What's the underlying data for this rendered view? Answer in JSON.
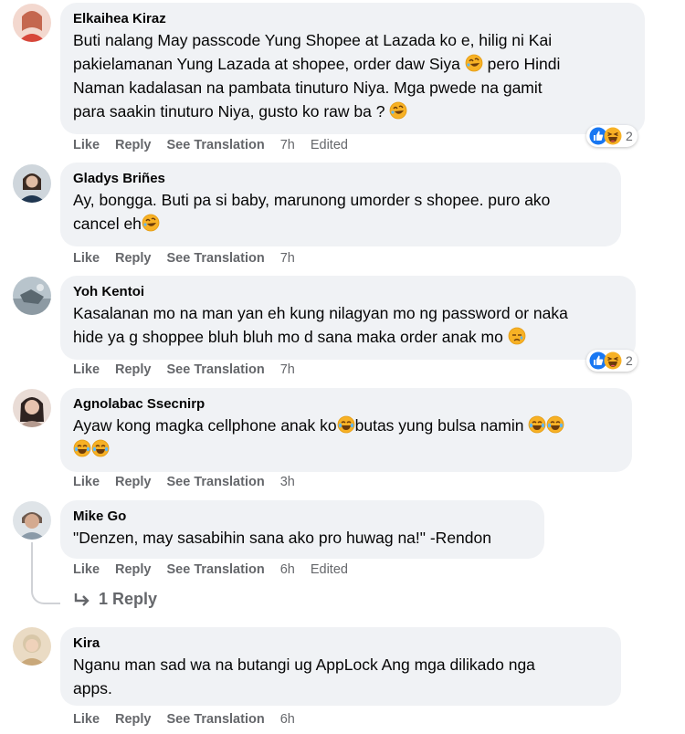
{
  "actions": {
    "like": "Like",
    "reply": "Reply",
    "see_translation": "See Translation"
  },
  "comments": [
    {
      "author": "Elkaihea Kiraz",
      "lines": [
        "Buti nalang May passcode Yung Shopee at Lazada ko e, hilig ni Kai",
        "pakielamanan Yung Lazada at shopee, order daw Siya",
        "pero Hindi",
        "Naman kadalasan na pambata tinuturo Niya. Mga pwede na gamit",
        "para saakin tinuturo Niya, gusto ko raw ba ?"
      ],
      "time": "7h",
      "edited": "Edited",
      "reaction_count": "2"
    },
    {
      "author": "Gladys Briñes",
      "lines": [
        "Ay, bongga. Buti pa si baby, marunong umorder s shopee. puro ako",
        "cancel eh"
      ],
      "time": "7h"
    },
    {
      "author": "Yoh Kentoi",
      "lines": [
        "Kasalanan mo na man yan eh kung nilagyan mo ng password or naka",
        "hide ya g shoppee bluh bluh mo d sana maka order anak mo"
      ],
      "time": "7h",
      "reaction_count": "2"
    },
    {
      "author": "Agnolabac Ssecnirp",
      "lines": [
        "Ayaw kong magka cellphone anak ko",
        "butas yung bulsa namin"
      ],
      "time": "3h"
    },
    {
      "author": "Mike Go",
      "lines": [
        "\"Denzen, may sasabihin sana ako pro huwag na!\" -Rendon"
      ],
      "time": "6h",
      "edited": "Edited",
      "replies": "1 Reply"
    },
    {
      "author": "Kira",
      "lines": [
        "Nganu man sad wa na butangi ug AppLock Ang mga dilikado nga",
        "apps."
      ],
      "time": "6h"
    }
  ],
  "icons": [
    "rolling-laugh-emoji-icon",
    "tears-of-joy-emoji-icon",
    "sad-emoji-icon",
    "like-reaction-icon",
    "haha-reaction-icon",
    "reply-arrow-icon"
  ],
  "colors": {
    "bubble": "#f0f2f5",
    "meta": "#65676b",
    "like_blue": "#1877f2",
    "emoji_yellow": "#f7b125"
  }
}
